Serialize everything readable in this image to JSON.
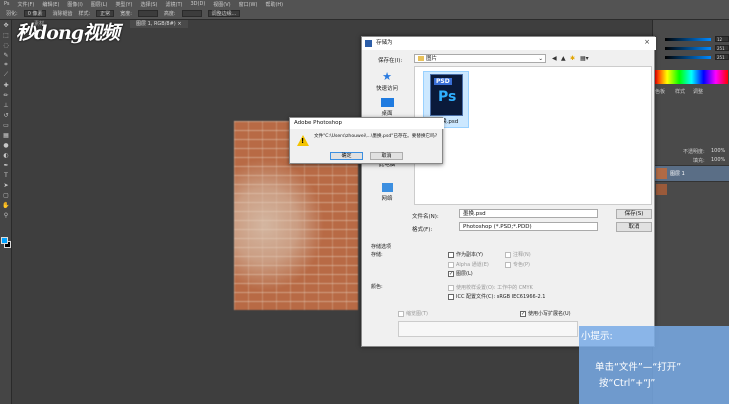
{
  "app": {
    "menu": [
      "Ps",
      "文件(F)",
      "编辑(E)",
      "图像(I)",
      "图层(L)",
      "类型(Y)",
      "选择(S)",
      "滤镜(T)",
      "3D(D)",
      "视图(V)",
      "窗口(W)",
      "帮助(H)"
    ],
    "options": {
      "feather_label": "羽化:",
      "feather_value": "0 像素",
      "antialias": "消除锯齿",
      "style_label": "样式:",
      "style_value": "正常",
      "width_label": "宽度:",
      "height_label": "高度:",
      "refine": "调整边缘..."
    },
    "doc_tab": "图层 1, RGB/8#) ×",
    "doc_tab_left": "素材"
  },
  "watermark": "秒dong视频",
  "right_panel": {
    "color_values": [
      "12",
      "251",
      "251"
    ],
    "opacity_label": "不透明度:",
    "opacity_value": "100%",
    "fill_label": "填充:",
    "fill_value": "100%",
    "layer_name": "图层 1",
    "panel_labels": [
      "色板",
      "样式",
      "调整"
    ]
  },
  "save_dialog": {
    "title": "存储为",
    "save_in_label": "保存在(I):",
    "save_in_value": "图片",
    "nav": [
      "快速访问",
      "桌面",
      "库",
      "此电脑",
      "网络"
    ],
    "file_name": "墨换.psd",
    "filename_label": "文件名(N):",
    "filename_value": "墨换.psd",
    "format_label": "格式(F):",
    "format_value": "Photoshop (*.PSD;*.PDD)",
    "save_button": "保存(S)",
    "cancel_button": "取消",
    "options_title": "存储选项",
    "save_label": "存储:",
    "opts_left": [
      "作为副本(Y)",
      "Alpha 通道(E)",
      "图层(L)"
    ],
    "opts_right": [
      "注释(N)",
      "专色(P)"
    ],
    "color_label": "颜色:",
    "color_opts": [
      "使用校样设置(O): 工作中的 CMYK",
      "ICC 配置文件(C): sRGB IEC61966-2.1"
    ],
    "thumb_label": "缩览图(T)",
    "lowercase_label": "使用小写扩展名(U)"
  },
  "alert": {
    "title": "Adobe Photoshop",
    "message": "文件\"C:\\Users\\zhouwei\\...\\墨换.psd\"已存在。要替换它吗?",
    "ok": "确定",
    "cancel": "取消"
  },
  "tip": {
    "title": "小提示:",
    "line1": "单击“文件”—“打开”",
    "line2": "按“Ctrl”+“J”"
  },
  "colors": {
    "accent": "#2d5ea8",
    "tip_bg": "#78aae6",
    "psd_blue": "#30b0ff"
  }
}
